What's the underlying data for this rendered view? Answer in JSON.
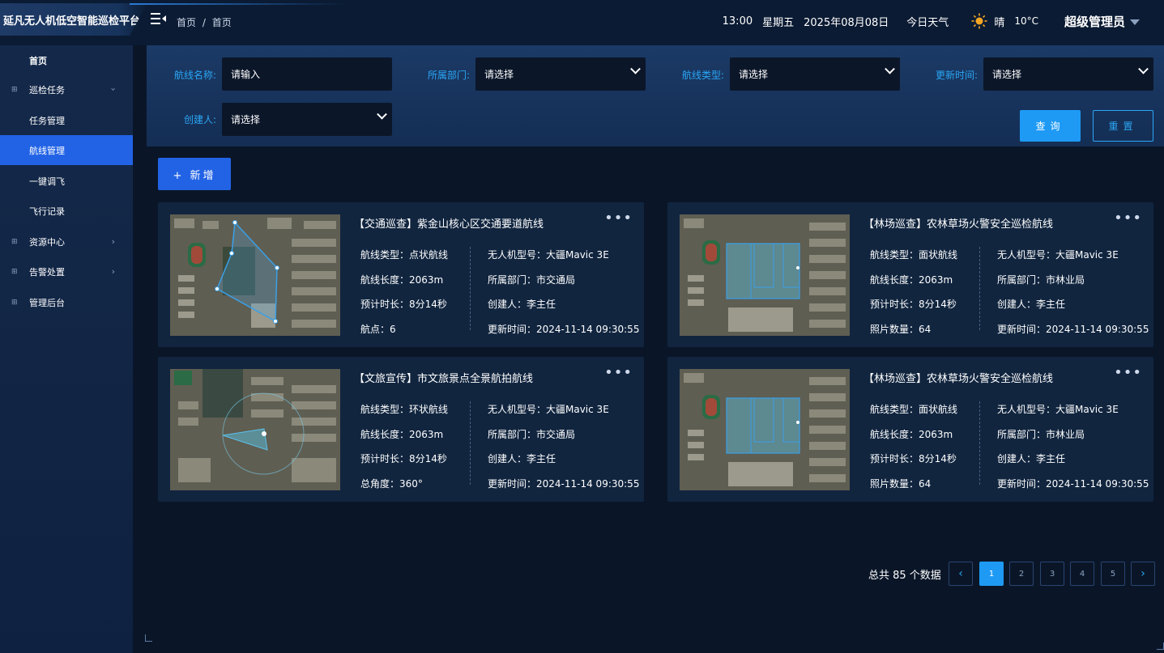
{
  "app_title": "延凡无人机低空智能巡检平台",
  "breadcrumb": [
    "首页",
    "/",
    "首页"
  ],
  "header": {
    "time": "13:00",
    "weekday": "星期五",
    "date": "2025年08月08日",
    "weather_label": "今日天气",
    "weather": "晴",
    "temperature": "10°C",
    "user": "超级管理员"
  },
  "sidebar": {
    "items": [
      {
        "label": "首页",
        "level": 0
      },
      {
        "label": "巡检任务",
        "level": 0
      },
      {
        "label": "任务管理",
        "level": 1
      },
      {
        "label": "航线管理",
        "level": 1
      },
      {
        "label": "一键调飞",
        "level": 1
      },
      {
        "label": "飞行记录",
        "level": 1
      },
      {
        "label": "资源中心",
        "level": 0
      },
      {
        "label": "告警处置",
        "level": 0
      },
      {
        "label": "管理后台",
        "level": 0
      }
    ]
  },
  "filters": {
    "route_name_label": "航线名称:",
    "route_name_placeholder": "请输入",
    "dept_label": "所属部门:",
    "dept_value": "请选择",
    "type_label": "航线类型:",
    "type_value": "请选择",
    "update_label": "更新时间:",
    "update_value": "请选择",
    "creator_label": "创建人:",
    "creator_value": "请选择",
    "query_label": "查询",
    "reset_label": "重置"
  },
  "add_label": "+ 新增",
  "cards": [
    {
      "title": "【交通巡查】紫金山核心区交通要道航线",
      "f1": "航线类型：点状航线",
      "f2": "航线长度：2063m",
      "f3": "预计时长：8分14秒",
      "f4": "航点：6",
      "g1": "无人机型号：大疆Mavic 3E",
      "g2": "所属部门：市交通局",
      "g3": "创建人：李主任",
      "g4": "更新时间：2024-11-14 09:30:55"
    },
    {
      "title": "【林场巡查】农林草场火警安全巡检航线",
      "f1": "航线类型：面状航线",
      "f2": "航线长度：2063m",
      "f3": "预计时长：8分14秒",
      "f4": "照片数量：64",
      "g1": "无人机型号：大疆Mavic 3E",
      "g2": "所属部门：市林业局",
      "g3": "创建人：李主任",
      "g4": "更新时间：2024-11-14 09:30:55"
    },
    {
      "title": "【文旅宣传】市文旅景点全景航拍航线",
      "f1": "航线类型：环状航线",
      "f2": "航线长度：2063m",
      "f3": "预计时长：8分14秒",
      "f4": "总角度：360°",
      "g1": "无人机型号：大疆Mavic 3E",
      "g2": "所属部门：市交通局",
      "g3": "创建人：李主任",
      "g4": "更新时间：2024-11-14 09:30:55"
    },
    {
      "title": "【林场巡查】农林草场火警安全巡检航线",
      "f1": "航线类型：面状航线",
      "f2": "航线长度：2063m",
      "f3": "预计时长：8分14秒",
      "f4": "照片数量：64",
      "g1": "无人机型号：大疆Mavic 3E",
      "g2": "所属部门：市林业局",
      "g3": "创建人：李主任",
      "g4": "更新时间：2024-11-14 09:30:55"
    }
  ],
  "pagination": {
    "total": "总共 85 个数据",
    "pages": [
      "1",
      "2",
      "3",
      "4",
      "5"
    ],
    "prev_icon": "chevron-left-icon",
    "next_icon": "chevron-right-icon"
  },
  "colors": {
    "accent": "#2263e6",
    "cyan": "#2ba6f5",
    "background": "#0a1628"
  }
}
